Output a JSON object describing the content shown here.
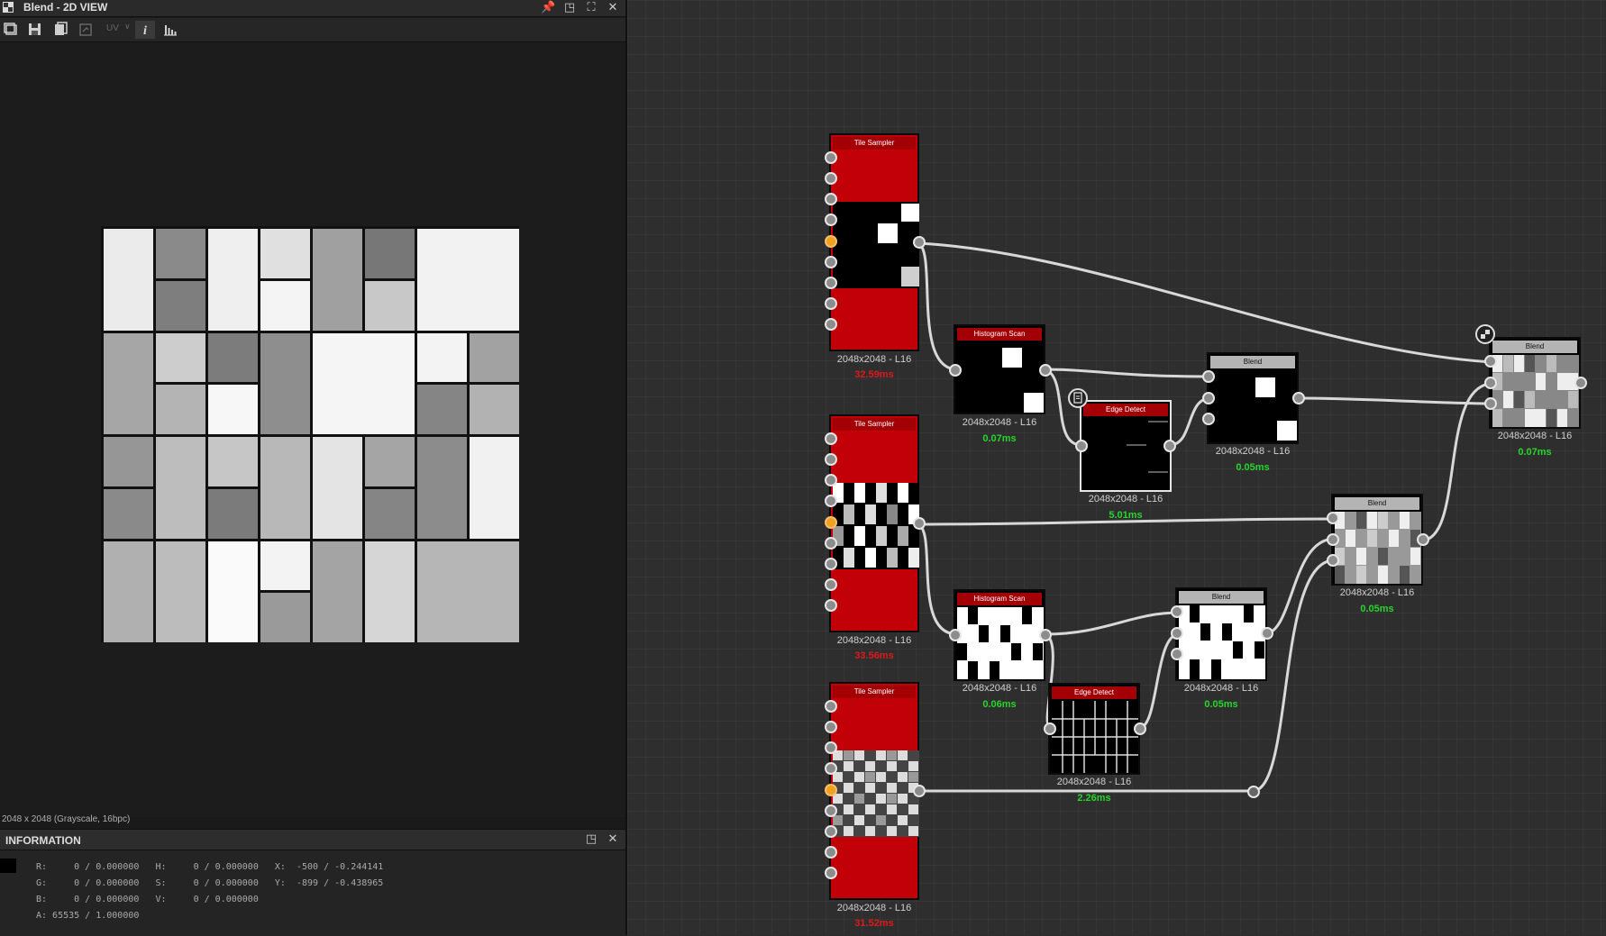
{
  "window": {
    "title": "Blend - 2D VIEW",
    "icons": [
      "pin-icon",
      "restore-icon",
      "maximize-icon",
      "close-icon"
    ]
  },
  "toolbar": {
    "buttons": [
      "copy-icon",
      "save-icon",
      "export-icon",
      "compare-icon"
    ],
    "uv_label": "UV",
    "info_icon": "i",
    "histogram_icon": "histogram-icon"
  },
  "image_meta": "2048 x 2048 (Grayscale, 16bpc)",
  "info": {
    "title": "INFORMATION",
    "lines": [
      "R:     0 / 0.000000   H:     0 / 0.000000   X:  -500 / -0.244141",
      "G:     0 / 0.000000   S:     0 / 0.000000   Y:  -899 / -0.438965",
      "B:     0 / 0.000000   V:     0 / 0.000000",
      "A: 65535 / 1.000000"
    ]
  },
  "nodes": [
    {
      "id": "tile-sampler-1",
      "title": "Tile Sampler",
      "size": "2048x2048 - L16",
      "time": "32.59ms",
      "time_color": "red"
    },
    {
      "id": "tile-sampler-2",
      "title": "Tile Sampler",
      "size": "2048x2048 - L16",
      "time": "33.56ms",
      "time_color": "red"
    },
    {
      "id": "tile-sampler-3",
      "title": "Tile Sampler",
      "size": "2048x2048 - L16",
      "time": "31.52ms",
      "time_color": "red"
    },
    {
      "id": "histogram-scan-1",
      "title": "Histogram Scan",
      "size": "2048x2048 - L16",
      "time": "0.07ms",
      "time_color": "green"
    },
    {
      "id": "edge-detect-1",
      "title": "Edge Detect",
      "size": "2048x2048 - L16",
      "time": "5.01ms",
      "time_color": "green"
    },
    {
      "id": "blend-1",
      "title": "Blend",
      "size": "2048x2048 - L16",
      "time": "0.05ms",
      "time_color": "green"
    },
    {
      "id": "blend-output",
      "title": "Blend",
      "size": "2048x2048 - L16",
      "time": "0.07ms",
      "time_color": "green"
    },
    {
      "id": "blend-2",
      "title": "Blend",
      "size": "2048x2048 - L16",
      "time": "0.05ms",
      "time_color": "green"
    },
    {
      "id": "histogram-scan-2",
      "title": "Histogram Scan",
      "size": "2048x2048 - L16",
      "time": "0.06ms",
      "time_color": "green"
    },
    {
      "id": "blend-3",
      "title": "Blend",
      "size": "2048x2048 - L16",
      "time": "0.05ms",
      "time_color": "green"
    },
    {
      "id": "edge-detect-2",
      "title": "Edge Detect",
      "size": "2048x2048 - L16",
      "time": "2.26ms",
      "time_color": "green"
    }
  ],
  "colors": {
    "red_time": "#e0191d",
    "green_time": "#27d52b",
    "node_red": "#a30005",
    "port_orange": "#f0a020"
  }
}
